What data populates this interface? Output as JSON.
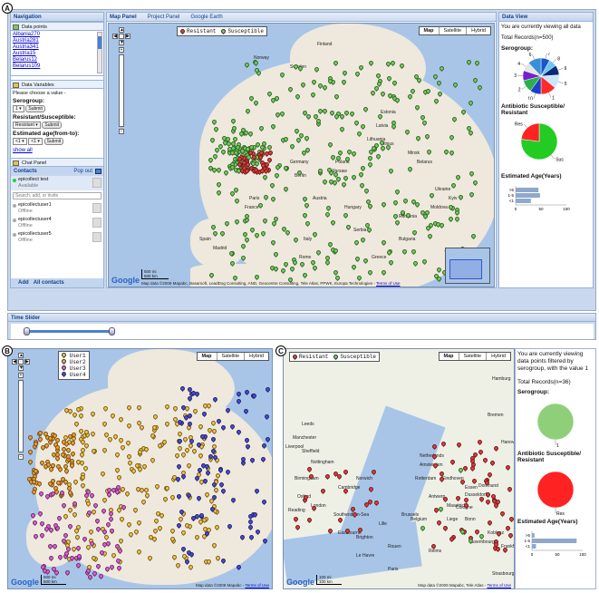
{
  "badges": {
    "a": "A",
    "b": "B",
    "c": "C"
  },
  "nav": {
    "title": "Navigation",
    "data_points": "Data points",
    "points": [
      "Albania270",
      "Austria281",
      "Austria341",
      "Austria15",
      "Belarus12",
      "Belarus109"
    ],
    "data_variables": "Data Variables",
    "choose": "Please choose a value -",
    "serogroup_label": "Serogroup:",
    "serogroup_value": "1",
    "resistant_label": "Resistant/Susceptible:",
    "resistant_value": "Resistant",
    "age_label": "Estimated age(from-to):",
    "age_from": "<1",
    "age_to": "<1",
    "submit": "Submit",
    "show_all": "show all"
  },
  "chat": {
    "title": "Chat Panel",
    "contacts": "Contacts",
    "pop_out": "Pop out",
    "search_placeholder": "Search, add, or invite",
    "users": [
      {
        "name": "epicollect test",
        "status": "Available"
      },
      {
        "name": "epicollectuser1",
        "status": "Offline"
      },
      {
        "name": "epicollectuser4",
        "status": "Offline"
      },
      {
        "name": "epicollectuser5",
        "status": "Offline"
      }
    ],
    "add": "Add",
    "all_contacts": "All contacts"
  },
  "mapPanel": {
    "tabs": [
      "Map Panel",
      "Project Panel",
      "Google Earth"
    ],
    "legend": [
      "Resistant",
      "Susceptible"
    ],
    "maptypes": [
      "Map",
      "Satellite",
      "Hybrid"
    ],
    "scale": [
      "500 mi",
      "500 km"
    ],
    "attribution": "Map data ©2009 Mapabc, Basarsoft, LeadDog Consulting, AND, Geocentre Consulting, Tele Atlas, PPWK, Europa Technologies",
    "terms": "Terms of Use",
    "cities": [
      "Finland",
      "Sweden",
      "Norway",
      "Estonia",
      "Latvia",
      "Lithuania",
      "Poland",
      "Belarus",
      "Ukraine",
      "Germany",
      "France",
      "Spain",
      "Italy",
      "Romania",
      "Turkey",
      "Greece",
      "Sea",
      "Moldova",
      "Vilnius",
      "Minsk",
      "Kyiv",
      "Warsaw",
      "Berlin",
      "Paris",
      "Madrid",
      "Rome",
      "Austria",
      "Hungary",
      "Serbia",
      "Bulgaria"
    ]
  },
  "dataView": {
    "title": "Data View",
    "viewing": "You are currently viewing all data",
    "total": "Total Records(n=500)",
    "serogroup": "Serogroup:",
    "antibiotic": "Antibiotic Susceptible/ Resistant",
    "age": "Estimated Age(Years)",
    "pie_labels": [
      "7",
      "8",
      "9",
      "5",
      "1",
      "10",
      "2",
      "3",
      "4",
      "6"
    ],
    "res_labels": [
      "Sus",
      "Res"
    ],
    "age_cats": [
      ">5",
      "1-5",
      "<1"
    ],
    "age_ticks": [
      "0",
      "50",
      "100"
    ]
  },
  "timeSlider": {
    "title": "Time Slider"
  },
  "panelB": {
    "legend": [
      "User1",
      "User2",
      "User3",
      "User4"
    ],
    "maptypes": [
      "Map",
      "Satellite",
      "Hybrid"
    ],
    "scale": [
      "500 mi",
      "500 km"
    ],
    "attribution": "Map data ©2009 Mapabc",
    "terms": "Terms of Use"
  },
  "panelC": {
    "legend": [
      "Resistant",
      "Susceptible"
    ],
    "maptypes": [
      "Map",
      "Satellite",
      "Hybrid"
    ],
    "scale": [
      "100 mi",
      "100 km"
    ],
    "attribution": "Map data ©2009 Mapabc, Tele Atlas",
    "terms": "Terms of Use",
    "viewing": "You are currently viewing data points filtered by serogroup, with the value 1",
    "total": "Total Records(n=36)",
    "serogroup": "Serogroup:",
    "antibiotic": "Antibiotic Susceptible/ Resistant",
    "age": "Estimated Age(Years)",
    "pie1_label": "1",
    "pie2_label": "Res",
    "age_cats": [
      ">5",
      "1-5",
      "<1"
    ],
    "age_ticks": [
      "0",
      "50",
      "100"
    ],
    "cities": [
      "Manchester",
      "Liverpool",
      "Sheffield",
      "Nottingham",
      "Birmingham",
      "London",
      "Cambridge",
      "Norwich",
      "Leeds",
      "Amsterdam",
      "Rotterdam",
      "Antwerp",
      "Brussels",
      "Lille",
      "Paris",
      "Dusseldorf",
      "Cologne",
      "Dortmund",
      "Essen",
      "Le Havre",
      "Rouen",
      "Reims",
      "Strasbourg",
      "Netherlands",
      "Belgium",
      "Southend-on-Sea",
      "Eastbourne",
      "Brighton",
      "Oxford",
      "Reading",
      "Luxembourg",
      "Koblenz",
      "Bonn",
      "Liege",
      "Maastricht",
      "Eindhoven",
      "Hamburg",
      "Bremen",
      "Hanover",
      "Frankfurt"
    ]
  },
  "chart_data": [
    {
      "type": "pie",
      "title": "Serogroup:",
      "categories": [
        "7",
        "8",
        "9",
        "5",
        "1",
        "10",
        "2",
        "3",
        "4",
        "6"
      ],
      "values": [
        8,
        7,
        9,
        12,
        14,
        10,
        11,
        9,
        8,
        12
      ],
      "colors": [
        "#1b56c8",
        "#6ec6f0",
        "#0c2a7a",
        "#c8e6ff",
        "#ff2a2a",
        "#1e40c8",
        "#2ab04a",
        "#7a1dd0",
        "#e5e5e5",
        "#3a8fd8"
      ]
    },
    {
      "type": "pie",
      "title": "Antibiotic Susceptible/ Resistant",
      "categories": [
        "Sus",
        "Res"
      ],
      "values": [
        77,
        23
      ],
      "colors": [
        "#22cc22",
        "#ff2222"
      ]
    },
    {
      "type": "bar",
      "title": "Estimated Age(Years)",
      "categories": [
        ">5",
        "1-5",
        "<1"
      ],
      "values": [
        45,
        48,
        30
      ],
      "xlim": [
        0,
        100
      ]
    },
    {
      "type": "pie",
      "title": "Serogroup:",
      "categories": [
        "1"
      ],
      "values": [
        100
      ],
      "colors": [
        "#8fcf7a"
      ]
    },
    {
      "type": "pie",
      "title": "Antibiotic Susceptible/ Resistant",
      "categories": [
        "Res"
      ],
      "values": [
        100
      ],
      "colors": [
        "#ff2222"
      ]
    },
    {
      "type": "bar",
      "title": "Estimated Age(Years)",
      "categories": [
        ">5",
        "1-5",
        "<1"
      ],
      "values": [
        5,
        88,
        8
      ],
      "xlim": [
        0,
        100
      ]
    }
  ],
  "colors": {
    "resistant": "#e53a3a",
    "susceptible": "#6fd05a",
    "user1": "#f4d03f",
    "user2": "#f5c242",
    "user3": "#e05cd6",
    "user4": "#4a4ad8",
    "water": "#a8c5e8",
    "land": "#efe9dc"
  }
}
